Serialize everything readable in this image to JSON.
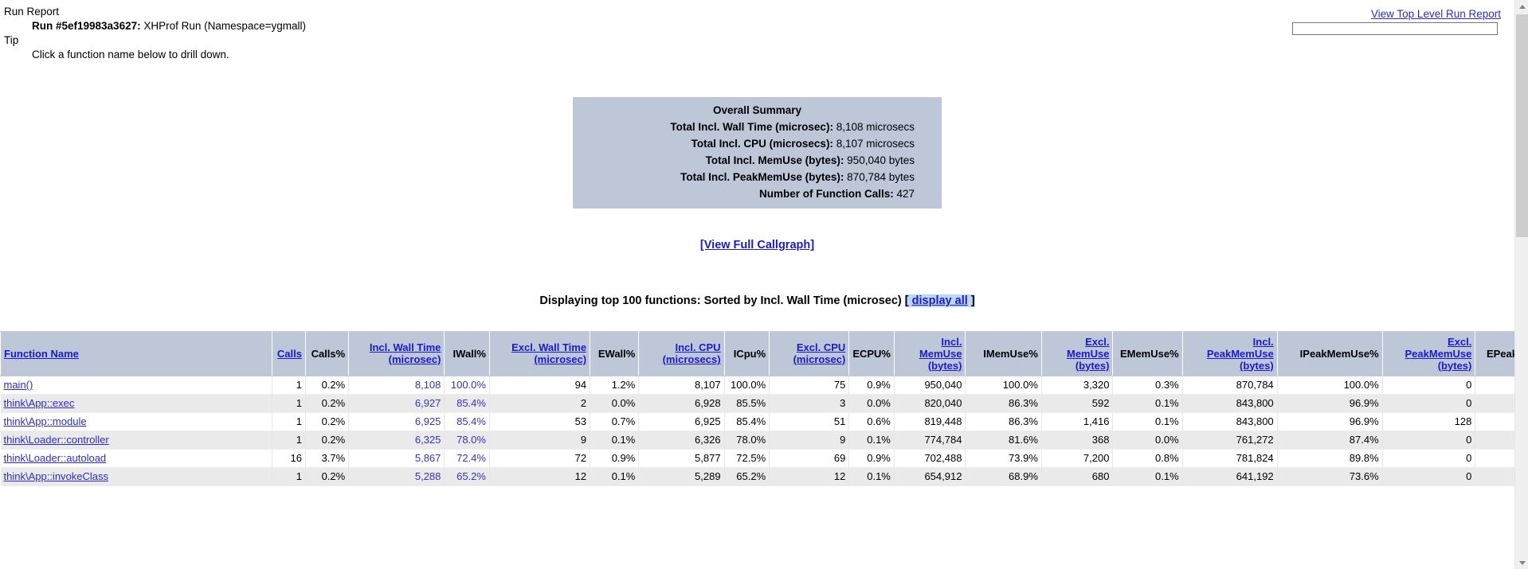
{
  "header": {
    "run_report_label": "Run Report",
    "run_id_label": "Run #5ef19983a3627:",
    "run_description": " XHProf Run (Namespace=ygmall)",
    "tip_label": "Tip",
    "tip_text": "Click a function name below to drill down.",
    "top_level_link": "View Top Level Run Report",
    "search_value": "",
    "search_placeholder": ""
  },
  "summary": {
    "title": "Overall Summary",
    "rows": [
      {
        "label": "Total Incl. Wall Time (microsec):",
        "value": "8,108 microsecs"
      },
      {
        "label": "Total Incl. CPU (microsecs):",
        "value": "8,107 microsecs"
      },
      {
        "label": "Total Incl. MemUse (bytes):",
        "value": "950,040 bytes"
      },
      {
        "label": "Total Incl. PeakMemUse (bytes):",
        "value": "870,784 bytes"
      },
      {
        "label": "Number of Function Calls:",
        "value": "427"
      }
    ]
  },
  "callgraph": {
    "link_label": "[View Full Callgraph]"
  },
  "display_line": {
    "text": "Displaying top 100 functions: Sorted by Incl. Wall Time (microsec)",
    "bracket_open": "[ ",
    "display_all_label": "display all",
    "bracket_close": " ]"
  },
  "table": {
    "columns": [
      {
        "label": "Function Name",
        "link": true,
        "align": "left",
        "sorted": false
      },
      {
        "label": "Calls",
        "link": true,
        "align": "right",
        "sorted": false
      },
      {
        "label": "Calls%",
        "link": false,
        "align": "right",
        "sorted": false
      },
      {
        "label": "Incl. Wall Time (microsec)",
        "link": true,
        "align": "right",
        "sorted": true
      },
      {
        "label": "IWall%",
        "link": false,
        "align": "right",
        "sorted": true
      },
      {
        "label": "Excl. Wall Time (microsec)",
        "link": true,
        "align": "right",
        "sorted": false
      },
      {
        "label": "EWall%",
        "link": false,
        "align": "right",
        "sorted": false
      },
      {
        "label": "Incl. CPU (microsecs)",
        "link": true,
        "align": "right",
        "sorted": false
      },
      {
        "label": "ICpu%",
        "link": false,
        "align": "right",
        "sorted": false
      },
      {
        "label": "Excl. CPU (microsec)",
        "link": true,
        "align": "right",
        "sorted": false
      },
      {
        "label": "ECPU%",
        "link": false,
        "align": "right",
        "sorted": false
      },
      {
        "label": "Incl. MemUse (bytes)",
        "link": true,
        "align": "right",
        "sorted": false
      },
      {
        "label": "IMemUse%",
        "link": false,
        "align": "right",
        "sorted": false
      },
      {
        "label": "Excl. MemUse (bytes)",
        "link": true,
        "align": "right",
        "sorted": false
      },
      {
        "label": "EMemUse%",
        "link": false,
        "align": "right",
        "sorted": false
      },
      {
        "label": "Incl. PeakMemUse (bytes)",
        "link": true,
        "align": "right",
        "sorted": false
      },
      {
        "label": "IPeakMemUse%",
        "link": false,
        "align": "right",
        "sorted": false
      },
      {
        "label": "Excl. PeakMemUse (bytes)",
        "link": true,
        "align": "right",
        "sorted": false
      },
      {
        "label": "EPeakMemUse%",
        "link": false,
        "align": "right",
        "sorted": false
      }
    ],
    "rows": [
      {
        "function": "main()",
        "calls": "1",
        "calls_pct": "0.2%",
        "incl_wall": "8,108",
        "iwall_pct": "100.0%",
        "excl_wall": "94",
        "ewall_pct": "1.2%",
        "incl_cpu": "8,107",
        "icpu_pct": "100.0%",
        "excl_cpu": "75",
        "ecpu_pct": "0.9%",
        "incl_mem": "950,040",
        "imem_pct": "100.0%",
        "excl_mem": "3,320",
        "emem_pct": "0.3%",
        "incl_peak": "870,784",
        "ipeak_pct": "100.0%",
        "excl_peak": "0",
        "epeak_pct": ""
      },
      {
        "function": "think\\App::exec",
        "calls": "1",
        "calls_pct": "0.2%",
        "incl_wall": "6,927",
        "iwall_pct": "85.4%",
        "excl_wall": "2",
        "ewall_pct": "0.0%",
        "incl_cpu": "6,928",
        "icpu_pct": "85.5%",
        "excl_cpu": "3",
        "ecpu_pct": "0.0%",
        "incl_mem": "820,040",
        "imem_pct": "86.3%",
        "excl_mem": "592",
        "emem_pct": "0.1%",
        "incl_peak": "843,800",
        "ipeak_pct": "96.9%",
        "excl_peak": "0",
        "epeak_pct": ""
      },
      {
        "function": "think\\App::module",
        "calls": "1",
        "calls_pct": "0.2%",
        "incl_wall": "6,925",
        "iwall_pct": "85.4%",
        "excl_wall": "53",
        "ewall_pct": "0.7%",
        "incl_cpu": "6,925",
        "icpu_pct": "85.4%",
        "excl_cpu": "51",
        "ecpu_pct": "0.6%",
        "incl_mem": "819,448",
        "imem_pct": "86.3%",
        "excl_mem": "1,416",
        "emem_pct": "0.1%",
        "incl_peak": "843,800",
        "ipeak_pct": "96.9%",
        "excl_peak": "128",
        "epeak_pct": ""
      },
      {
        "function": "think\\Loader::controller",
        "calls": "1",
        "calls_pct": "0.2%",
        "incl_wall": "6,325",
        "iwall_pct": "78.0%",
        "excl_wall": "9",
        "ewall_pct": "0.1%",
        "incl_cpu": "6,326",
        "icpu_pct": "78.0%",
        "excl_cpu": "9",
        "ecpu_pct": "0.1%",
        "incl_mem": "774,784",
        "imem_pct": "81.6%",
        "excl_mem": "368",
        "emem_pct": "0.0%",
        "incl_peak": "761,272",
        "ipeak_pct": "87.4%",
        "excl_peak": "0",
        "epeak_pct": ""
      },
      {
        "function": "think\\Loader::autoload",
        "calls": "16",
        "calls_pct": "3.7%",
        "incl_wall": "5,867",
        "iwall_pct": "72.4%",
        "excl_wall": "72",
        "ewall_pct": "0.9%",
        "incl_cpu": "5,877",
        "icpu_pct": "72.5%",
        "excl_cpu": "69",
        "ecpu_pct": "0.9%",
        "incl_mem": "702,488",
        "imem_pct": "73.9%",
        "excl_mem": "7,200",
        "emem_pct": "0.8%",
        "incl_peak": "781,824",
        "ipeak_pct": "89.8%",
        "excl_peak": "0",
        "epeak_pct": ""
      },
      {
        "function": "think\\App::invokeClass",
        "calls": "1",
        "calls_pct": "0.2%",
        "incl_wall": "5,288",
        "iwall_pct": "65.2%",
        "excl_wall": "12",
        "ewall_pct": "0.1%",
        "incl_cpu": "5,289",
        "icpu_pct": "65.2%",
        "excl_cpu": "12",
        "ecpu_pct": "0.1%",
        "incl_mem": "654,912",
        "imem_pct": "68.9%",
        "excl_mem": "680",
        "emem_pct": "0.1%",
        "incl_peak": "641,192",
        "ipeak_pct": "73.6%",
        "excl_peak": "0",
        "epeak_pct": ""
      }
    ]
  },
  "scrollbar": {
    "up_arrow": "scroll-up-arrow",
    "down_arrow": "scroll-down-arrow"
  }
}
